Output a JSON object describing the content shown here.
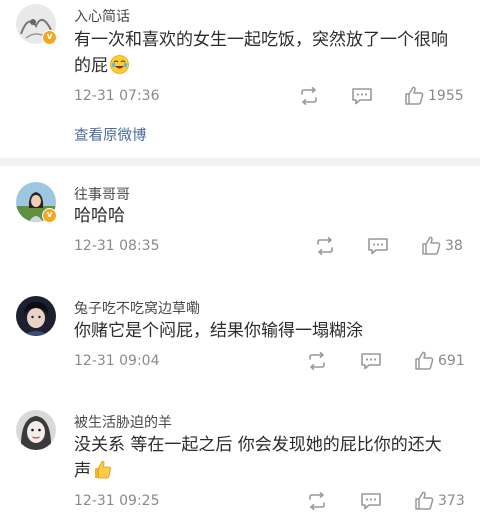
{
  "comments": [
    {
      "user": "入心简话",
      "text": "有一次和喜欢的女生一起吃饭，突然放了一个很响的屁",
      "emoji": "laughing-tears-emoji",
      "time": "12-31 07:36",
      "likes": "1955",
      "verified": true,
      "extra_link": "查看原微博"
    },
    {
      "user": "往事哥哥",
      "text": "哈哈哈",
      "time": "12-31 08:35",
      "likes": "38",
      "verified": true
    },
    {
      "user": "兔子吃不吃窝边草嘞",
      "text": "你赌它是个闷屁，结果你输得一塌糊涂",
      "time": "12-31 09:04",
      "likes": "691",
      "verified": false
    },
    {
      "user": "被生活胁迫的羊",
      "text": "没关系 等在一起之后 你会发现她的屁比你的还大声",
      "emoji": "thumbs-up-emoji",
      "time": "12-31 09:25",
      "likes": "373",
      "verified": false
    }
  ],
  "icons": {
    "repost": "repost-icon",
    "comment": "comment-icon",
    "like": "thumbs-up-icon",
    "verified": "verified-badge"
  },
  "colors": {
    "link": "#4a6d9c",
    "badge": "#f5a623",
    "meta": "#8a8a8a"
  }
}
